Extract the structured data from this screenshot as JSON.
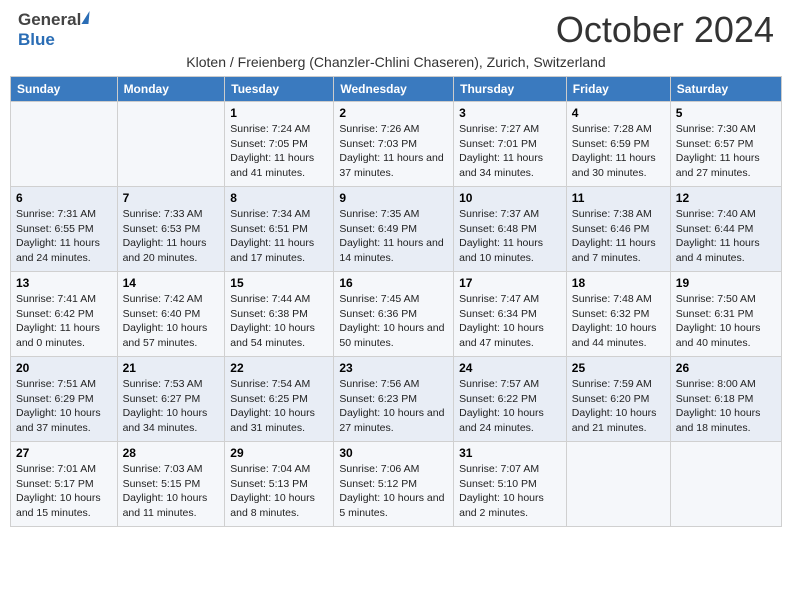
{
  "header": {
    "logo_general": "General",
    "logo_blue": "Blue",
    "title": "October 2024",
    "subtitle": "Kloten / Freienberg (Chanzler-Chlini Chaseren), Zurich, Switzerland"
  },
  "columns": [
    "Sunday",
    "Monday",
    "Tuesday",
    "Wednesday",
    "Thursday",
    "Friday",
    "Saturday"
  ],
  "weeks": [
    [
      {
        "day": "",
        "info": ""
      },
      {
        "day": "",
        "info": ""
      },
      {
        "day": "1",
        "info": "Sunrise: 7:24 AM\nSunset: 7:05 PM\nDaylight: 11 hours and 41 minutes."
      },
      {
        "day": "2",
        "info": "Sunrise: 7:26 AM\nSunset: 7:03 PM\nDaylight: 11 hours and 37 minutes."
      },
      {
        "day": "3",
        "info": "Sunrise: 7:27 AM\nSunset: 7:01 PM\nDaylight: 11 hours and 34 minutes."
      },
      {
        "day": "4",
        "info": "Sunrise: 7:28 AM\nSunset: 6:59 PM\nDaylight: 11 hours and 30 minutes."
      },
      {
        "day": "5",
        "info": "Sunrise: 7:30 AM\nSunset: 6:57 PM\nDaylight: 11 hours and 27 minutes."
      }
    ],
    [
      {
        "day": "6",
        "info": "Sunrise: 7:31 AM\nSunset: 6:55 PM\nDaylight: 11 hours and 24 minutes."
      },
      {
        "day": "7",
        "info": "Sunrise: 7:33 AM\nSunset: 6:53 PM\nDaylight: 11 hours and 20 minutes."
      },
      {
        "day": "8",
        "info": "Sunrise: 7:34 AM\nSunset: 6:51 PM\nDaylight: 11 hours and 17 minutes."
      },
      {
        "day": "9",
        "info": "Sunrise: 7:35 AM\nSunset: 6:49 PM\nDaylight: 11 hours and 14 minutes."
      },
      {
        "day": "10",
        "info": "Sunrise: 7:37 AM\nSunset: 6:48 PM\nDaylight: 11 hours and 10 minutes."
      },
      {
        "day": "11",
        "info": "Sunrise: 7:38 AM\nSunset: 6:46 PM\nDaylight: 11 hours and 7 minutes."
      },
      {
        "day": "12",
        "info": "Sunrise: 7:40 AM\nSunset: 6:44 PM\nDaylight: 11 hours and 4 minutes."
      }
    ],
    [
      {
        "day": "13",
        "info": "Sunrise: 7:41 AM\nSunset: 6:42 PM\nDaylight: 11 hours and 0 minutes."
      },
      {
        "day": "14",
        "info": "Sunrise: 7:42 AM\nSunset: 6:40 PM\nDaylight: 10 hours and 57 minutes."
      },
      {
        "day": "15",
        "info": "Sunrise: 7:44 AM\nSunset: 6:38 PM\nDaylight: 10 hours and 54 minutes."
      },
      {
        "day": "16",
        "info": "Sunrise: 7:45 AM\nSunset: 6:36 PM\nDaylight: 10 hours and 50 minutes."
      },
      {
        "day": "17",
        "info": "Sunrise: 7:47 AM\nSunset: 6:34 PM\nDaylight: 10 hours and 47 minutes."
      },
      {
        "day": "18",
        "info": "Sunrise: 7:48 AM\nSunset: 6:32 PM\nDaylight: 10 hours and 44 minutes."
      },
      {
        "day": "19",
        "info": "Sunrise: 7:50 AM\nSunset: 6:31 PM\nDaylight: 10 hours and 40 minutes."
      }
    ],
    [
      {
        "day": "20",
        "info": "Sunrise: 7:51 AM\nSunset: 6:29 PM\nDaylight: 10 hours and 37 minutes."
      },
      {
        "day": "21",
        "info": "Sunrise: 7:53 AM\nSunset: 6:27 PM\nDaylight: 10 hours and 34 minutes."
      },
      {
        "day": "22",
        "info": "Sunrise: 7:54 AM\nSunset: 6:25 PM\nDaylight: 10 hours and 31 minutes."
      },
      {
        "day": "23",
        "info": "Sunrise: 7:56 AM\nSunset: 6:23 PM\nDaylight: 10 hours and 27 minutes."
      },
      {
        "day": "24",
        "info": "Sunrise: 7:57 AM\nSunset: 6:22 PM\nDaylight: 10 hours and 24 minutes."
      },
      {
        "day": "25",
        "info": "Sunrise: 7:59 AM\nSunset: 6:20 PM\nDaylight: 10 hours and 21 minutes."
      },
      {
        "day": "26",
        "info": "Sunrise: 8:00 AM\nSunset: 6:18 PM\nDaylight: 10 hours and 18 minutes."
      }
    ],
    [
      {
        "day": "27",
        "info": "Sunrise: 7:01 AM\nSunset: 5:17 PM\nDaylight: 10 hours and 15 minutes."
      },
      {
        "day": "28",
        "info": "Sunrise: 7:03 AM\nSunset: 5:15 PM\nDaylight: 10 hours and 11 minutes."
      },
      {
        "day": "29",
        "info": "Sunrise: 7:04 AM\nSunset: 5:13 PM\nDaylight: 10 hours and 8 minutes."
      },
      {
        "day": "30",
        "info": "Sunrise: 7:06 AM\nSunset: 5:12 PM\nDaylight: 10 hours and 5 minutes."
      },
      {
        "day": "31",
        "info": "Sunrise: 7:07 AM\nSunset: 5:10 PM\nDaylight: 10 hours and 2 minutes."
      },
      {
        "day": "",
        "info": ""
      },
      {
        "day": "",
        "info": ""
      }
    ]
  ]
}
